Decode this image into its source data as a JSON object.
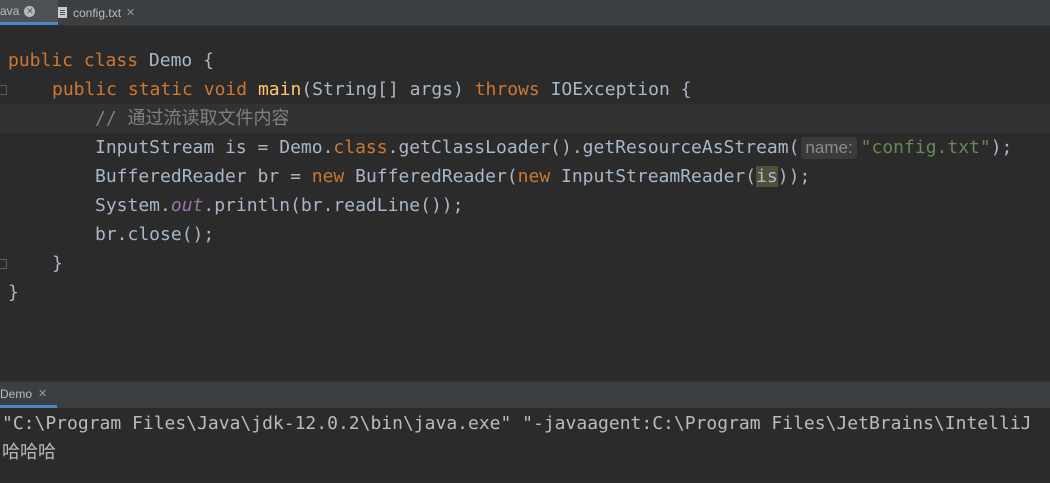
{
  "tabs": [
    {
      "label": "ava",
      "active": true
    },
    {
      "label": "config.txt",
      "active": false
    }
  ],
  "code": {
    "line1": {
      "kw1": "public",
      "kw2": "class",
      "name": "Demo {"
    },
    "line2": {
      "kw1": "public",
      "kw2": "static",
      "kw3": "void",
      "method": "main",
      "params": "(String[] args) ",
      "throws": "throws",
      "exc": "IOException {"
    },
    "line3": {
      "comment_prefix": "// ",
      "comment_text": "通过流读取文件内容"
    },
    "line4": {
      "a": "InputStream is = Demo.",
      "kw": "class",
      "b": ".getClassLoader().getResourceAsStream(",
      "hint": "name:",
      "str": "\"config.txt\"",
      "end": ");"
    },
    "line5": {
      "a": "BufferedReader br = ",
      "kw1": "new",
      "b": " BufferedReader(",
      "kw2": "new",
      "c": " InputStreamReader(",
      "var": "is",
      "end": "));"
    },
    "line6": {
      "a": "System.",
      "field": "out",
      "b": ".println(br.readLine());"
    },
    "line7": {
      "a": "br.close();"
    },
    "line8": {
      "a": "}"
    },
    "line9": {
      "a": "}"
    }
  },
  "run": {
    "tab_label": "Demo",
    "console": {
      "line1": "\"C:\\Program Files\\Java\\jdk-12.0.2\\bin\\java.exe\" \"-javaagent:C:\\Program Files\\JetBrains\\IntelliJ",
      "line2": "哈哈哈"
    }
  },
  "colors": {
    "background": "#2b2b2b",
    "keyword": "#cc7832",
    "method": "#ffc66d",
    "string": "#6a8759",
    "comment": "#808080",
    "static_field": "#9876aa",
    "text": "#a9b7c6",
    "accent": "#4a88c7"
  }
}
